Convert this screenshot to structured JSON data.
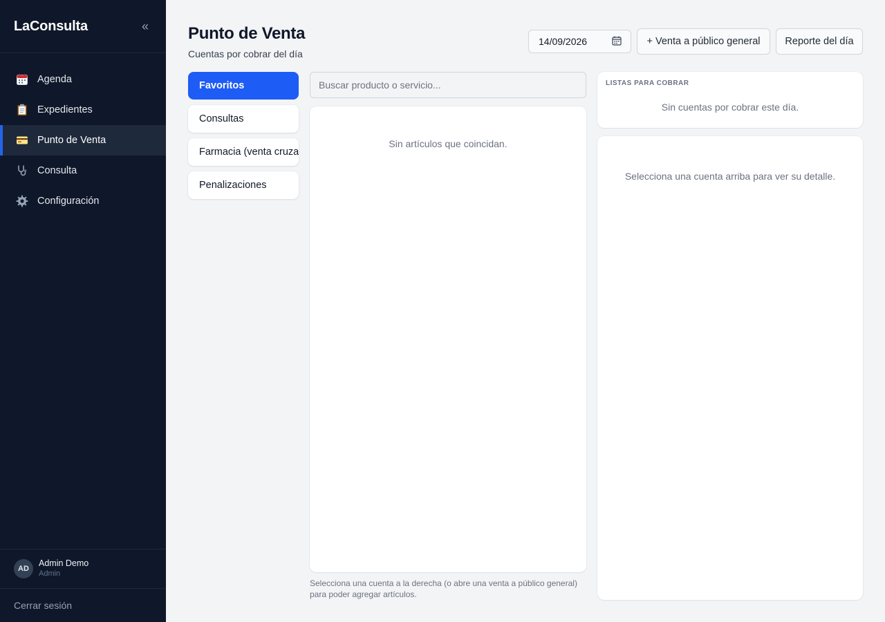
{
  "app": {
    "brand": "LaConsulta",
    "collapse_symbol": "«"
  },
  "sidebar": {
    "items": [
      {
        "label": "Agenda",
        "icon": "calendar-icon"
      },
      {
        "label": "Expedientes",
        "icon": "clipboard-icon"
      },
      {
        "label": "Punto de Venta",
        "icon": "credit-card-icon",
        "active": true
      },
      {
        "label": "Consulta",
        "icon": "stethoscope-icon"
      },
      {
        "label": "Configuración",
        "icon": "gear-icon"
      }
    ],
    "user": {
      "initials": "AD",
      "name": "Admin Demo",
      "role": "Admin"
    },
    "logout_label": "Cerrar sesión"
  },
  "header": {
    "title": "Punto de Venta",
    "subtitle": "Cuentas por cobrar del día",
    "date_value": "14/09/2026",
    "new_sale_label": "+ Venta a público general",
    "report_label": "Reporte del día"
  },
  "categories": [
    {
      "label": "Favoritos",
      "active": true
    },
    {
      "label": "Consultas"
    },
    {
      "label": "Farmacia (venta cruzada)"
    },
    {
      "label": "Penalizaciones"
    }
  ],
  "products": {
    "search_placeholder": "Buscar producto o servicio...",
    "empty_message": "Sin artículos que coincidan.",
    "hint": "Selecciona una cuenta a la derecha (o abre una venta a público general) para poder agregar artículos."
  },
  "lists": {
    "title": "LISTAS PARA COBRAR",
    "empty_message": "Sin cuentas por cobrar este día."
  },
  "detail": {
    "empty_message": "Selecciona una cuenta arriba para ver su detalle."
  },
  "colors": {
    "sidebar_bg": "#0f172a",
    "accent": "#1d5cf5",
    "page_bg": "#f3f4f6"
  }
}
